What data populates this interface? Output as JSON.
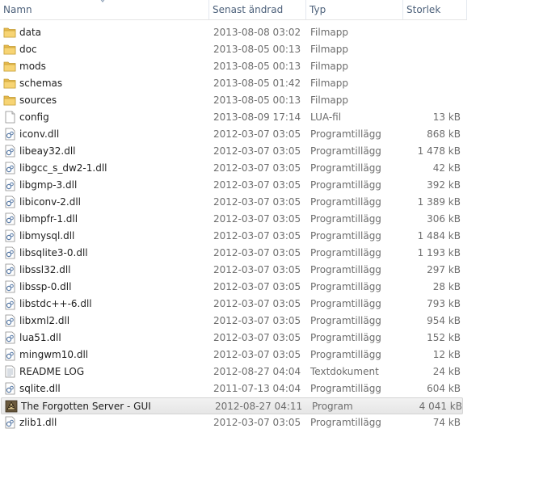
{
  "columns": {
    "name": "Namn",
    "modified": "Senast ändrad",
    "type": "Typ",
    "size": "Storlek"
  },
  "files": [
    {
      "name": "data",
      "modified": "2013-08-08 03:02",
      "type": "Filmapp",
      "size": "",
      "icon": "folder-icon"
    },
    {
      "name": "doc",
      "modified": "2013-08-05 00:13",
      "type": "Filmapp",
      "size": "",
      "icon": "folder-icon"
    },
    {
      "name": "mods",
      "modified": "2013-08-05 00:13",
      "type": "Filmapp",
      "size": "",
      "icon": "folder-icon"
    },
    {
      "name": "schemas",
      "modified": "2013-08-05 01:42",
      "type": "Filmapp",
      "size": "",
      "icon": "folder-icon"
    },
    {
      "name": "sources",
      "modified": "2013-08-05 00:13",
      "type": "Filmapp",
      "size": "",
      "icon": "folder-icon"
    },
    {
      "name": "config",
      "modified": "2013-08-09 17:14",
      "type": "LUA-fil",
      "size": "13 kB",
      "icon": "lua-file-icon"
    },
    {
      "name": "iconv.dll",
      "modified": "2012-03-07 03:05",
      "type": "Programtillägg",
      "size": "868 kB",
      "icon": "dll-file-icon"
    },
    {
      "name": "libeay32.dll",
      "modified": "2012-03-07 03:05",
      "type": "Programtillägg",
      "size": "1 478 kB",
      "icon": "dll-file-icon"
    },
    {
      "name": "libgcc_s_dw2-1.dll",
      "modified": "2012-03-07 03:05",
      "type": "Programtillägg",
      "size": "42 kB",
      "icon": "dll-file-icon"
    },
    {
      "name": "libgmp-3.dll",
      "modified": "2012-03-07 03:05",
      "type": "Programtillägg",
      "size": "392 kB",
      "icon": "dll-file-icon"
    },
    {
      "name": "libiconv-2.dll",
      "modified": "2012-03-07 03:05",
      "type": "Programtillägg",
      "size": "1 389 kB",
      "icon": "dll-file-icon"
    },
    {
      "name": "libmpfr-1.dll",
      "modified": "2012-03-07 03:05",
      "type": "Programtillägg",
      "size": "306 kB",
      "icon": "dll-file-icon"
    },
    {
      "name": "libmysql.dll",
      "modified": "2012-03-07 03:05",
      "type": "Programtillägg",
      "size": "1 484 kB",
      "icon": "dll-file-icon"
    },
    {
      "name": "libsqlite3-0.dll",
      "modified": "2012-03-07 03:05",
      "type": "Programtillägg",
      "size": "1 193 kB",
      "icon": "dll-file-icon"
    },
    {
      "name": "libssl32.dll",
      "modified": "2012-03-07 03:05",
      "type": "Programtillägg",
      "size": "297 kB",
      "icon": "dll-file-icon"
    },
    {
      "name": "libssp-0.dll",
      "modified": "2012-03-07 03:05",
      "type": "Programtillägg",
      "size": "28 kB",
      "icon": "dll-file-icon"
    },
    {
      "name": "libstdc++-6.dll",
      "modified": "2012-03-07 03:05",
      "type": "Programtillägg",
      "size": "793 kB",
      "icon": "dll-file-icon"
    },
    {
      "name": "libxml2.dll",
      "modified": "2012-03-07 03:05",
      "type": "Programtillägg",
      "size": "954 kB",
      "icon": "dll-file-icon"
    },
    {
      "name": "lua51.dll",
      "modified": "2012-03-07 03:05",
      "type": "Programtillägg",
      "size": "152 kB",
      "icon": "dll-file-icon"
    },
    {
      "name": "mingwm10.dll",
      "modified": "2012-03-07 03:05",
      "type": "Programtillägg",
      "size": "12 kB",
      "icon": "dll-file-icon"
    },
    {
      "name": "README LOG",
      "modified": "2012-08-27 04:04",
      "type": "Textdokument",
      "size": "24 kB",
      "icon": "text-file-icon"
    },
    {
      "name": "sqlite.dll",
      "modified": "2011-07-13 04:04",
      "type": "Programtillägg",
      "size": "604 kB",
      "icon": "dll-file-icon"
    },
    {
      "name": "The Forgotten Server - GUI",
      "modified": "2012-08-27 04:11",
      "type": "Program",
      "size": "4 041 kB",
      "icon": "program-icon",
      "selected": true
    },
    {
      "name": "zlib1.dll",
      "modified": "2012-03-07 03:05",
      "type": "Programtillägg",
      "size": "74 kB",
      "icon": "dll-file-icon"
    }
  ]
}
